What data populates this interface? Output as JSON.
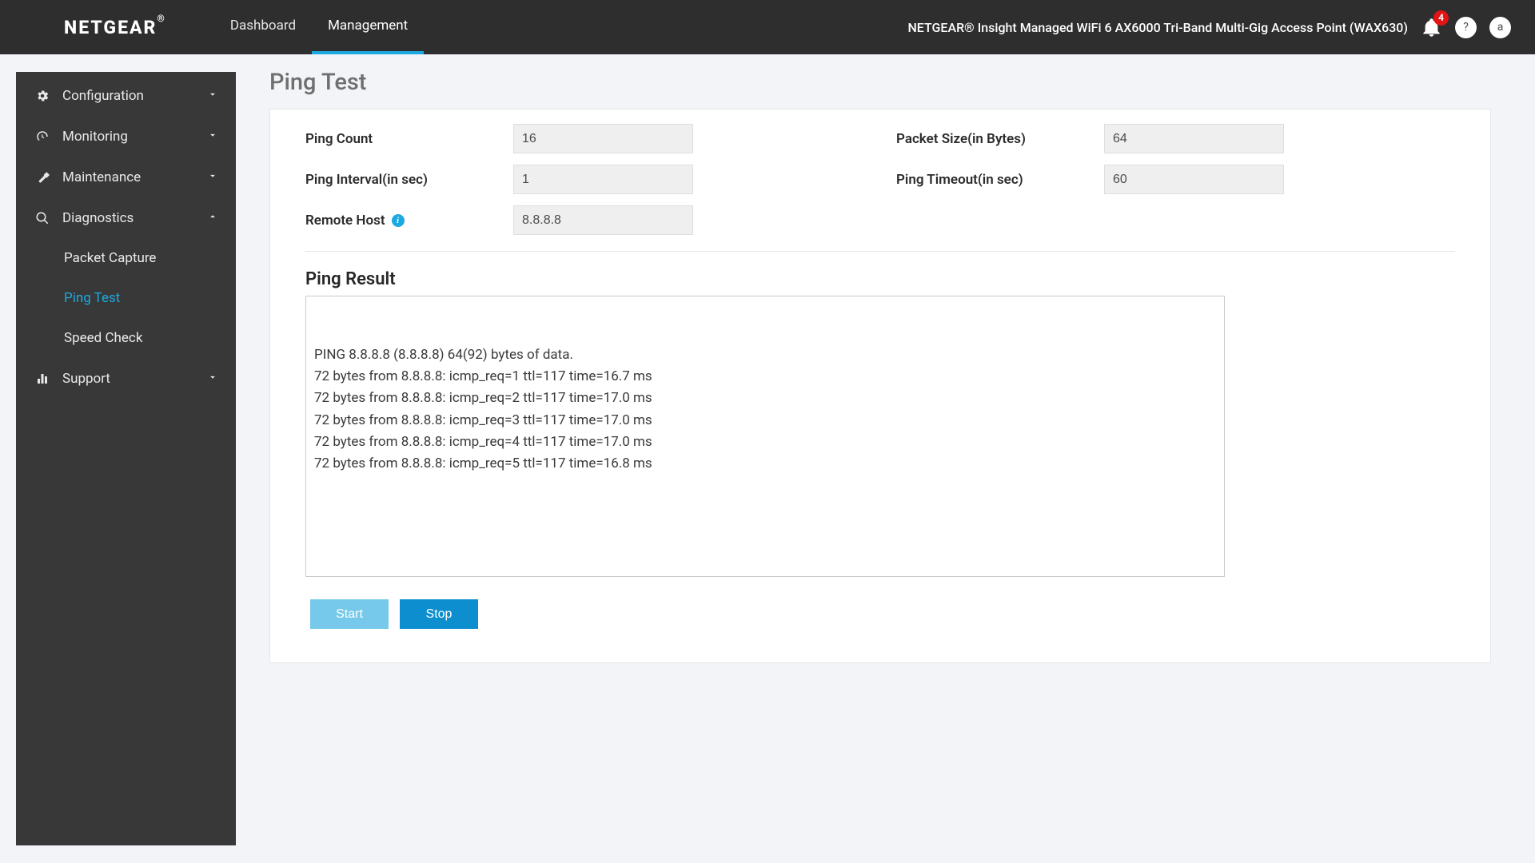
{
  "topbar": {
    "logo": "NETGEAR",
    "tabs": {
      "dashboard": "Dashboard",
      "management": "Management"
    },
    "product": "NETGEAR® Insight Managed WiFi 6 AX6000 Tri-Band Multi-Gig Access Point (WAX630)",
    "notification_count": "4",
    "help_label": "?",
    "user_label": "a"
  },
  "sidebar": {
    "configuration": "Configuration",
    "monitoring": "Monitoring",
    "maintenance": "Maintenance",
    "diagnostics": "Diagnostics",
    "support": "Support",
    "sub": {
      "packet_capture": "Packet Capture",
      "ping_test": "Ping Test",
      "speed_check": "Speed Check"
    }
  },
  "page": {
    "title": "Ping Test",
    "labels": {
      "ping_count": "Ping Count",
      "packet_size": "Packet Size(in Bytes)",
      "ping_interval": "Ping Interval(in sec)",
      "ping_timeout": "Ping Timeout(in sec)",
      "remote_host": "Remote Host"
    },
    "values": {
      "ping_count": "16",
      "packet_size": "64",
      "ping_interval": "1",
      "ping_timeout": "60",
      "remote_host": "8.8.8.8"
    },
    "result_title": "Ping Result",
    "result_text": "PING 8.8.8.8 (8.8.8.8) 64(92) bytes of data.\n72 bytes from 8.8.8.8: icmp_req=1 ttl=117 time=16.7 ms\n72 bytes from 8.8.8.8: icmp_req=2 ttl=117 time=17.0 ms\n72 bytes from 8.8.8.8: icmp_req=3 ttl=117 time=17.0 ms\n72 bytes from 8.8.8.8: icmp_req=4 ttl=117 time=17.0 ms\n72 bytes from 8.8.8.8: icmp_req=5 ttl=117 time=16.8 ms",
    "buttons": {
      "start": "Start",
      "stop": "Stop"
    }
  }
}
